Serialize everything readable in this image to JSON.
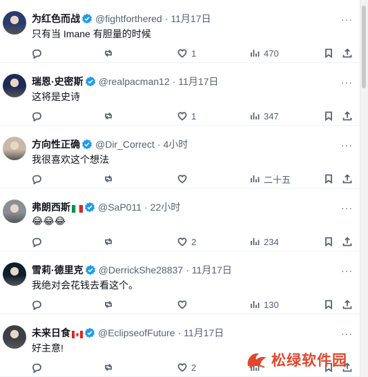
{
  "tweets": [
    {
      "name": "为红色而战",
      "handle": "@fightforthered",
      "time": "11月17日",
      "text": "只有当 Imane 有胆量的时候",
      "replies": "",
      "retweets": "",
      "likes": "1",
      "views": "470",
      "flag": "",
      "avatar_color": "#2a3b6e"
    },
    {
      "name": "瑞恩·史密斯",
      "handle": "@realpacman12",
      "time": "11月17日",
      "text": "这将是史诗",
      "replies": "",
      "retweets": "",
      "likes": "1",
      "views": "347",
      "flag": "",
      "avatar_color": "#1f2a55"
    },
    {
      "name": "方向性正确",
      "handle": "@Dir_Correct",
      "time": "4小时",
      "text": "我很喜欢这个想法",
      "replies": "",
      "retweets": "",
      "likes": "",
      "views": "二十五",
      "flag": "",
      "avatar_color": "#c9b9a6"
    },
    {
      "name": "弗朗西斯",
      "handle": "@SaP011",
      "time": "22小时",
      "text": "😂😂😂",
      "replies": "",
      "retweets": "",
      "likes": "2",
      "views": "234",
      "flag": "italy",
      "avatar_color": "#8a8f96"
    },
    {
      "name": "雪莉·德里克",
      "handle": "@DerrickShe28837",
      "time": "11月17日",
      "text": "我绝对会花钱去看这个。",
      "replies": "",
      "retweets": "",
      "likes": "",
      "views": "130",
      "flag": "",
      "avatar_color": "#0d1e2e"
    },
    {
      "name": "未来日食",
      "handle": "@EclipseofFuture",
      "time": "11月17日",
      "text": "好主意!",
      "replies": "",
      "retweets": "",
      "likes": "2",
      "views": "",
      "flag": "canada",
      "avatar_color": "#3b3f46"
    }
  ],
  "separator": "·",
  "more_label": "···",
  "watermark": {
    "text": "松绿软件园",
    "color": "#e0472e"
  },
  "colors": {
    "verified": "#1d9bf0",
    "secondary": "#536471",
    "primary": "#0f1419"
  }
}
